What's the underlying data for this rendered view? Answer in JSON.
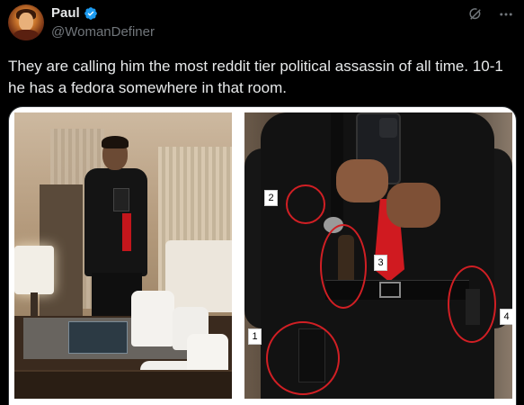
{
  "author": {
    "display_name": "Paul",
    "handle": "@WomanDefiner",
    "avatar": "avatar"
  },
  "icons": {
    "verified": "verified-badge-icon",
    "grok": "grok-icon",
    "more": "more-icon"
  },
  "colors": {
    "verified": "#1d9bf0",
    "annotation_ring": "#d11f24",
    "background": "#000000",
    "text_primary": "#e7e9ea",
    "text_secondary": "#71767b"
  },
  "tweet": {
    "text": "They are calling him the most reddit tier political assassin of all time. 10-1 he has a fedora somewhere in that room."
  },
  "media": {
    "annotations": [
      "1",
      "2",
      "3",
      "4"
    ]
  }
}
